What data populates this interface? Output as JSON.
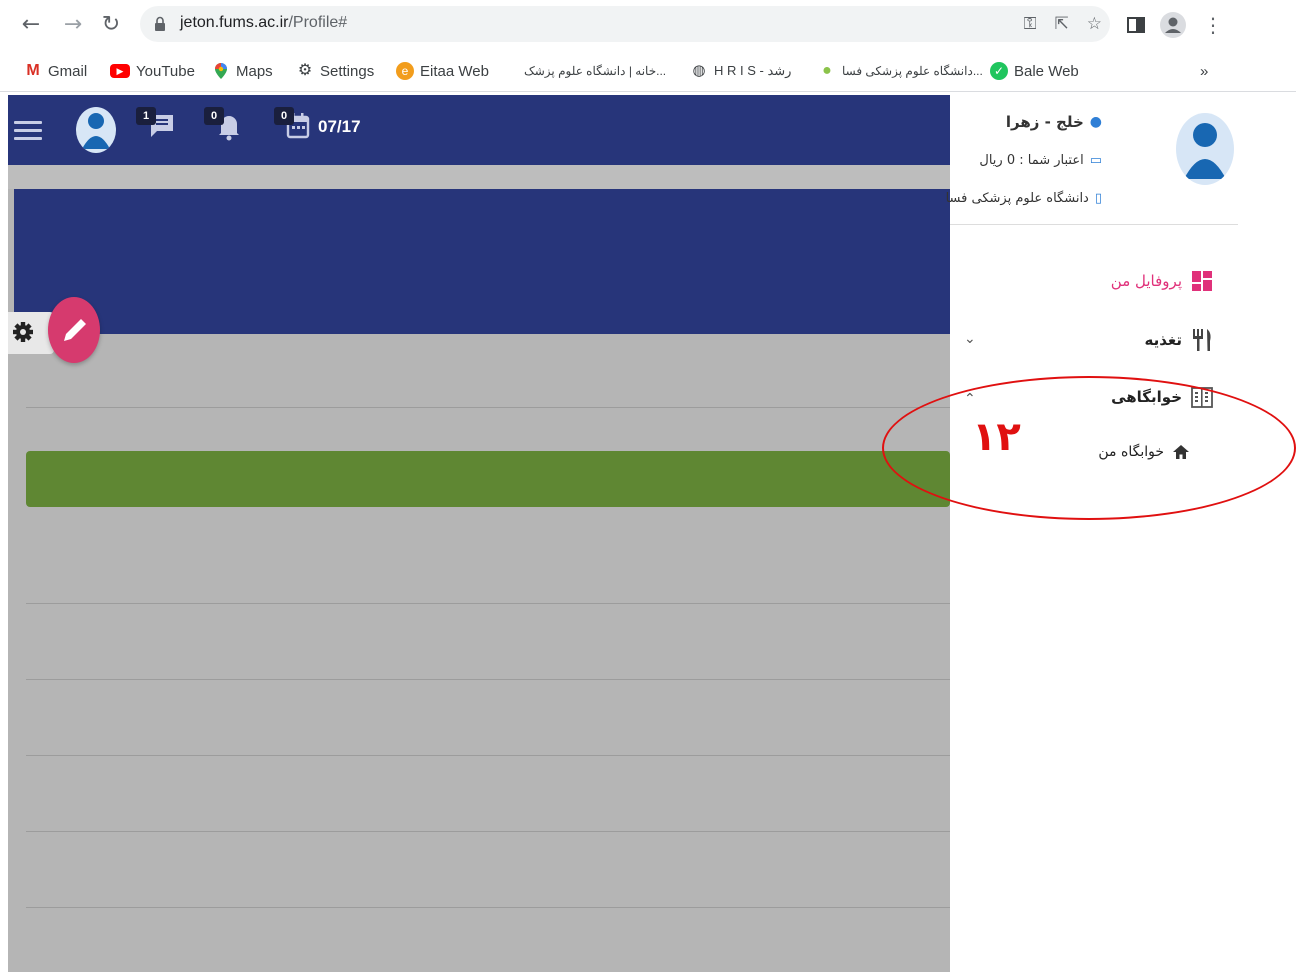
{
  "browser": {
    "url_host": "jeton.fums.ac.ir",
    "url_path": "/Profile#",
    "bookmarks": [
      {
        "label": "Gmail",
        "icon": "gmail-icon"
      },
      {
        "label": "YouTube",
        "icon": "youtube-icon"
      },
      {
        "label": "Maps",
        "icon": "maps-icon"
      },
      {
        "label": "Settings",
        "icon": "gear-icon"
      },
      {
        "label": "Eitaa Web",
        "icon": "eitaa-icon"
      },
      {
        "label": "خانه | دانشگاه علوم پزشک...",
        "icon": ""
      },
      {
        "label": "H R I S - رشد",
        "icon": "globe-icon"
      },
      {
        "label": "دانشگاه علوم پزشکی فسا...",
        "icon": "apple-icon"
      },
      {
        "label": "Bale Web",
        "icon": "bale-icon"
      }
    ],
    "more": "»"
  },
  "topbar": {
    "messages_count": "1",
    "notifications_count": "0",
    "calendar_count": "0",
    "date": "07/17"
  },
  "drawer": {
    "user_name": "خلج - زهرا",
    "credit": "اعتبار شما : 0 ریال",
    "university": "دانشگاه علوم پزشکی فسا",
    "menu": {
      "profile": "پروفایل من",
      "food": "تغذیه",
      "dorm": "خوابگاهی",
      "my_dorm": "خوابگاه من"
    }
  },
  "annotation": {
    "number": "۱۲"
  },
  "colors": {
    "topbar": "#27357a",
    "profile_accent": "#e0317a",
    "green_bar": "#5f8733",
    "annotation": "#e01010"
  }
}
